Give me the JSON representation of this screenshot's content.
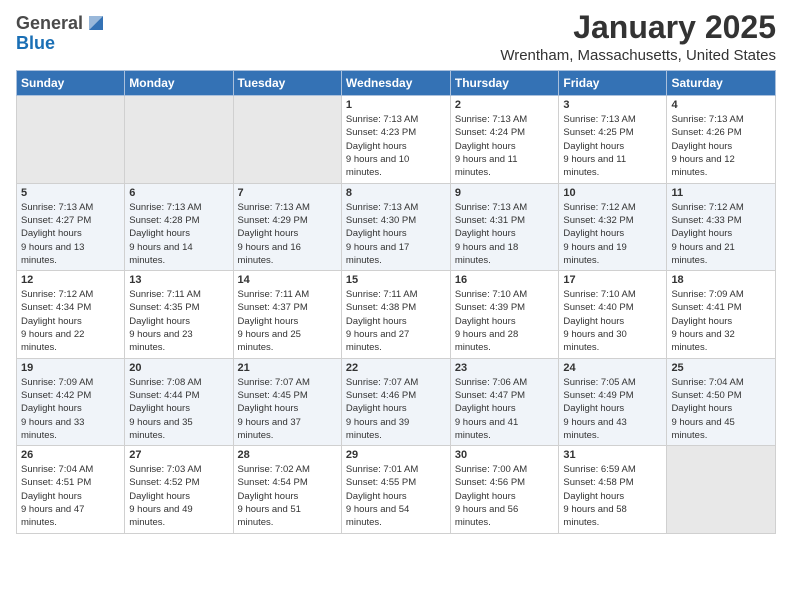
{
  "header": {
    "logo_general": "General",
    "logo_blue": "Blue",
    "month_title": "January 2025",
    "location": "Wrentham, Massachusetts, United States"
  },
  "days_of_week": [
    "Sunday",
    "Monday",
    "Tuesday",
    "Wednesday",
    "Thursday",
    "Friday",
    "Saturday"
  ],
  "weeks": [
    [
      {
        "day": "",
        "empty": true
      },
      {
        "day": "",
        "empty": true
      },
      {
        "day": "",
        "empty": true
      },
      {
        "day": "1",
        "sunrise": "7:13 AM",
        "sunset": "4:23 PM",
        "daylight": "9 hours and 10 minutes."
      },
      {
        "day": "2",
        "sunrise": "7:13 AM",
        "sunset": "4:24 PM",
        "daylight": "9 hours and 11 minutes."
      },
      {
        "day": "3",
        "sunrise": "7:13 AM",
        "sunset": "4:25 PM",
        "daylight": "9 hours and 11 minutes."
      },
      {
        "day": "4",
        "sunrise": "7:13 AM",
        "sunset": "4:26 PM",
        "daylight": "9 hours and 12 minutes."
      }
    ],
    [
      {
        "day": "5",
        "sunrise": "7:13 AM",
        "sunset": "4:27 PM",
        "daylight": "9 hours and 13 minutes."
      },
      {
        "day": "6",
        "sunrise": "7:13 AM",
        "sunset": "4:28 PM",
        "daylight": "9 hours and 14 minutes."
      },
      {
        "day": "7",
        "sunrise": "7:13 AM",
        "sunset": "4:29 PM",
        "daylight": "9 hours and 16 minutes."
      },
      {
        "day": "8",
        "sunrise": "7:13 AM",
        "sunset": "4:30 PM",
        "daylight": "9 hours and 17 minutes."
      },
      {
        "day": "9",
        "sunrise": "7:13 AM",
        "sunset": "4:31 PM",
        "daylight": "9 hours and 18 minutes."
      },
      {
        "day": "10",
        "sunrise": "7:12 AM",
        "sunset": "4:32 PM",
        "daylight": "9 hours and 19 minutes."
      },
      {
        "day": "11",
        "sunrise": "7:12 AM",
        "sunset": "4:33 PM",
        "daylight": "9 hours and 21 minutes."
      }
    ],
    [
      {
        "day": "12",
        "sunrise": "7:12 AM",
        "sunset": "4:34 PM",
        "daylight": "9 hours and 22 minutes."
      },
      {
        "day": "13",
        "sunrise": "7:11 AM",
        "sunset": "4:35 PM",
        "daylight": "9 hours and 23 minutes."
      },
      {
        "day": "14",
        "sunrise": "7:11 AM",
        "sunset": "4:37 PM",
        "daylight": "9 hours and 25 minutes."
      },
      {
        "day": "15",
        "sunrise": "7:11 AM",
        "sunset": "4:38 PM",
        "daylight": "9 hours and 27 minutes."
      },
      {
        "day": "16",
        "sunrise": "7:10 AM",
        "sunset": "4:39 PM",
        "daylight": "9 hours and 28 minutes."
      },
      {
        "day": "17",
        "sunrise": "7:10 AM",
        "sunset": "4:40 PM",
        "daylight": "9 hours and 30 minutes."
      },
      {
        "day": "18",
        "sunrise": "7:09 AM",
        "sunset": "4:41 PM",
        "daylight": "9 hours and 32 minutes."
      }
    ],
    [
      {
        "day": "19",
        "sunrise": "7:09 AM",
        "sunset": "4:42 PM",
        "daylight": "9 hours and 33 minutes."
      },
      {
        "day": "20",
        "sunrise": "7:08 AM",
        "sunset": "4:44 PM",
        "daylight": "9 hours and 35 minutes."
      },
      {
        "day": "21",
        "sunrise": "7:07 AM",
        "sunset": "4:45 PM",
        "daylight": "9 hours and 37 minutes."
      },
      {
        "day": "22",
        "sunrise": "7:07 AM",
        "sunset": "4:46 PM",
        "daylight": "9 hours and 39 minutes."
      },
      {
        "day": "23",
        "sunrise": "7:06 AM",
        "sunset": "4:47 PM",
        "daylight": "9 hours and 41 minutes."
      },
      {
        "day": "24",
        "sunrise": "7:05 AM",
        "sunset": "4:49 PM",
        "daylight": "9 hours and 43 minutes."
      },
      {
        "day": "25",
        "sunrise": "7:04 AM",
        "sunset": "4:50 PM",
        "daylight": "9 hours and 45 minutes."
      }
    ],
    [
      {
        "day": "26",
        "sunrise": "7:04 AM",
        "sunset": "4:51 PM",
        "daylight": "9 hours and 47 minutes."
      },
      {
        "day": "27",
        "sunrise": "7:03 AM",
        "sunset": "4:52 PM",
        "daylight": "9 hours and 49 minutes."
      },
      {
        "day": "28",
        "sunrise": "7:02 AM",
        "sunset": "4:54 PM",
        "daylight": "9 hours and 51 minutes."
      },
      {
        "day": "29",
        "sunrise": "7:01 AM",
        "sunset": "4:55 PM",
        "daylight": "9 hours and 54 minutes."
      },
      {
        "day": "30",
        "sunrise": "7:00 AM",
        "sunset": "4:56 PM",
        "daylight": "9 hours and 56 minutes."
      },
      {
        "day": "31",
        "sunrise": "6:59 AM",
        "sunset": "4:58 PM",
        "daylight": "9 hours and 58 minutes."
      },
      {
        "day": "",
        "empty": true
      }
    ]
  ]
}
